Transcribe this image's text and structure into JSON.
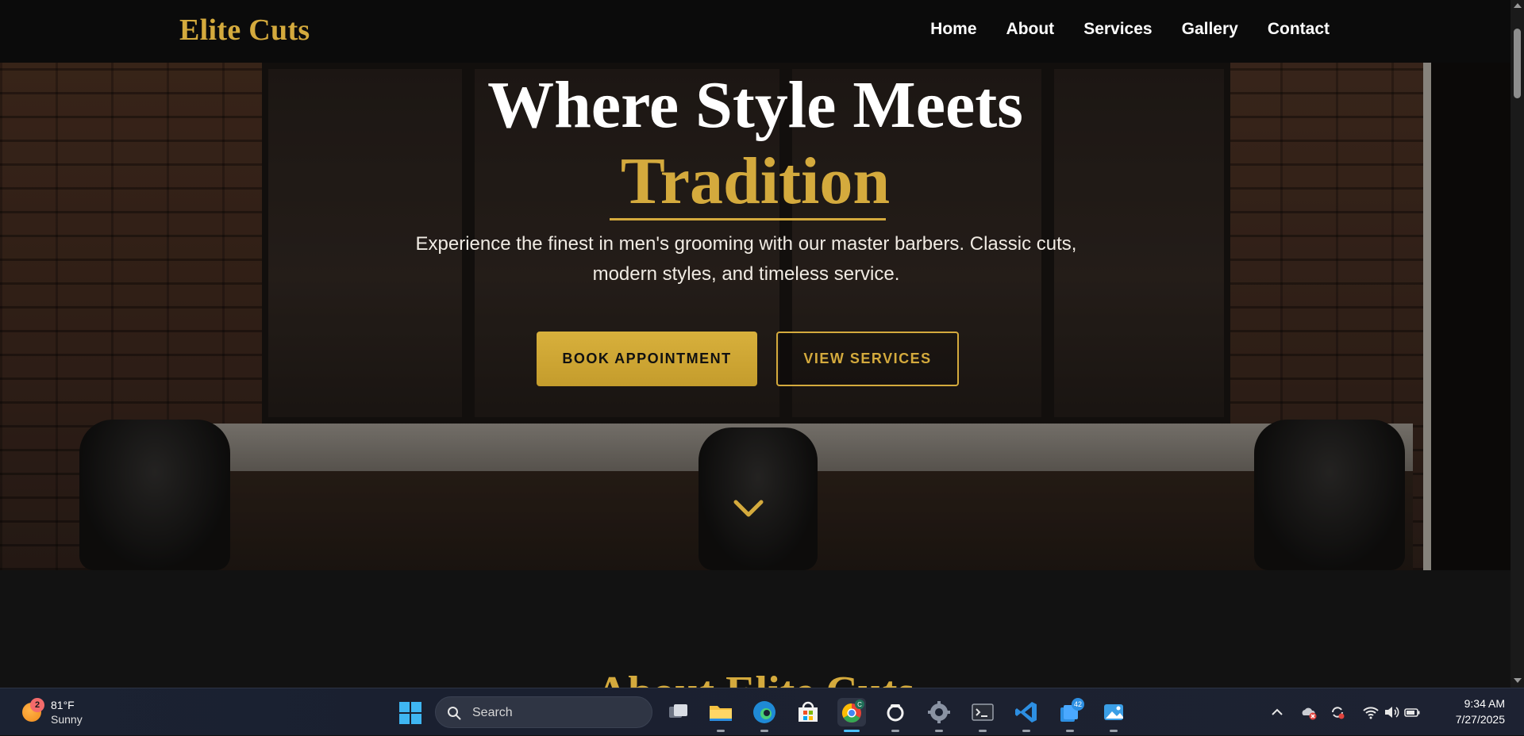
{
  "site": {
    "logo": "Elite Cuts",
    "nav": [
      "Home",
      "About",
      "Services",
      "Gallery",
      "Contact"
    ]
  },
  "hero": {
    "title_line1": "Where Style Meets",
    "title_accent": "Tradition",
    "subtitle": "Experience the finest in men's grooming with our master barbers. Classic cuts, modern styles, and timeless service.",
    "primary_button": "BOOK APPOINTMENT",
    "secondary_button": "VIEW SERVICES",
    "scroll_icon": "chevron-down-icon"
  },
  "about": {
    "heading": "About Elite Cuts"
  },
  "colors": {
    "accent_gold": "#d4aa3d",
    "nav_bg": "#0b0b0b",
    "page_bg": "#121212"
  },
  "taskbar": {
    "weather": {
      "badge": "2",
      "temp": "81°F",
      "desc": "Sunny"
    },
    "search_placeholder": "Search",
    "apps": [
      "task-view-icon",
      "file-explorer-icon",
      "edge-icon",
      "store-icon",
      "chrome-icon",
      "copilot-icon",
      "settings-icon",
      "terminal-icon",
      "vscode-icon",
      "todo-icon",
      "photos-icon"
    ],
    "todo_badge": "42",
    "chrome_profile_badge": "C",
    "clock": {
      "time": "9:34 AM",
      "date": "7/27/2025"
    }
  }
}
